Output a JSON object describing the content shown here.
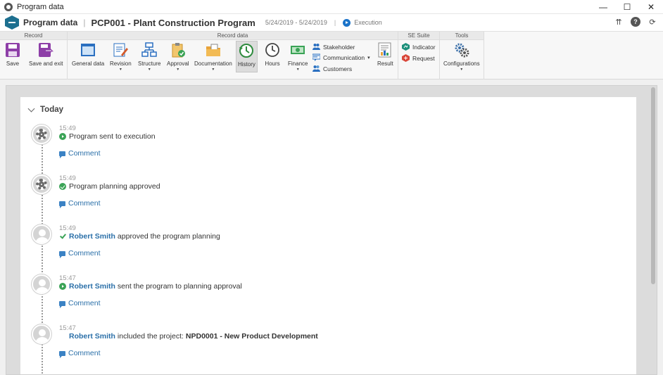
{
  "window": {
    "title": "Program data",
    "controls": {
      "minimize": "—",
      "maximize": "☐",
      "close": "✕"
    }
  },
  "header": {
    "module": "Program data",
    "separator": "|",
    "title": "PCP001 - Plant Construction Program",
    "dates": "5/24/2019 - 5/24/2019",
    "pipe": "|",
    "status": "Execution",
    "icons": {
      "collapse": "⇈",
      "help": "?",
      "refresh": "⟳"
    }
  },
  "ribbon": {
    "groups": [
      {
        "label": "Record"
      },
      {
        "label": "Record data"
      },
      {
        "label": "SE Suite"
      },
      {
        "label": "Tools"
      }
    ],
    "buttons": {
      "save": "Save",
      "save_exit": "Save and exit",
      "general_data": "General data",
      "revision": "Revision",
      "structure": "Structure",
      "approval": "Approval",
      "documentation": "Documentation",
      "history": "History",
      "hours": "Hours",
      "finance": "Finance",
      "stakeholder": "Stakeholder",
      "communication": "Communication",
      "customers": "Customers",
      "result": "Result",
      "indicator": "Indicator",
      "request": "Request",
      "configurations": "Configurations"
    },
    "dropdown_glyph": "▾"
  },
  "history": {
    "section_title": "Today",
    "entries": [
      {
        "time": "15:49",
        "user": "",
        "text": "Program sent to execution",
        "bold": "",
        "icon": "arrow",
        "comment": "Comment"
      },
      {
        "time": "15:49",
        "user": "",
        "text": "Program planning approved",
        "bold": "",
        "icon": "check",
        "comment": "Comment"
      },
      {
        "time": "15:49",
        "user": "Robert Smith",
        "text": "approved the program planning",
        "bold": "",
        "icon": "tick",
        "comment": "Comment"
      },
      {
        "time": "15:47",
        "user": "Robert Smith",
        "text": "sent the program to planning approval",
        "bold": "",
        "icon": "arrow",
        "comment": "Comment"
      },
      {
        "time": "15:47",
        "user": "Robert Smith",
        "text": "included the project:",
        "bold": "NPD0001 - New Product Development",
        "icon": "none",
        "comment": "Comment"
      }
    ]
  }
}
